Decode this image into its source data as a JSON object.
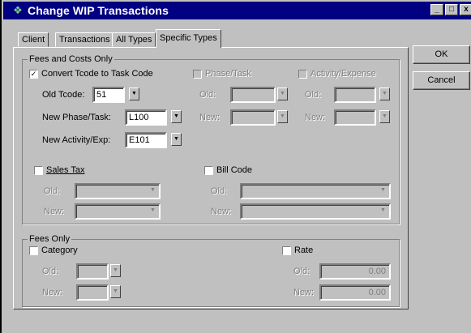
{
  "window": {
    "title": "Change WIP Transactions",
    "controls": [
      "_",
      "□",
      "x"
    ]
  },
  "tabs": [
    {
      "label": "Client"
    },
    {
      "label": "Transactions"
    },
    {
      "label": "All Types"
    },
    {
      "label": "Specific Types"
    }
  ],
  "buttons": {
    "ok": "OK",
    "cancel": "Cancel"
  },
  "fees_costs": {
    "legend": "Fees and Costs Only",
    "convert_label": "Convert Tcode to Task Code",
    "convert_checked": true,
    "old_tcode_label": "Old Tcode:",
    "old_tcode_value": "51",
    "new_phase_label": "New Phase/Task:",
    "new_phase_value": "L100",
    "new_activity_label": "New Activity/Exp:",
    "new_activity_value": "E101",
    "phase_task_label": "Phase/Task",
    "activity_expense_label": "Activity/Expense",
    "old_label": "Old:",
    "new_label": "New:",
    "sales_tax_label": "Sales Tax",
    "bill_code_label": "Bill Code"
  },
  "fees_only": {
    "legend": "Fees Only",
    "category_label": "Category",
    "rate_label": "Rate",
    "old_label": "Old:",
    "new_label": "New:",
    "rate_old_value": "0.00",
    "rate_new_value": "0.00"
  },
  "icons": {
    "check": "✓",
    "arrow": "▼"
  }
}
